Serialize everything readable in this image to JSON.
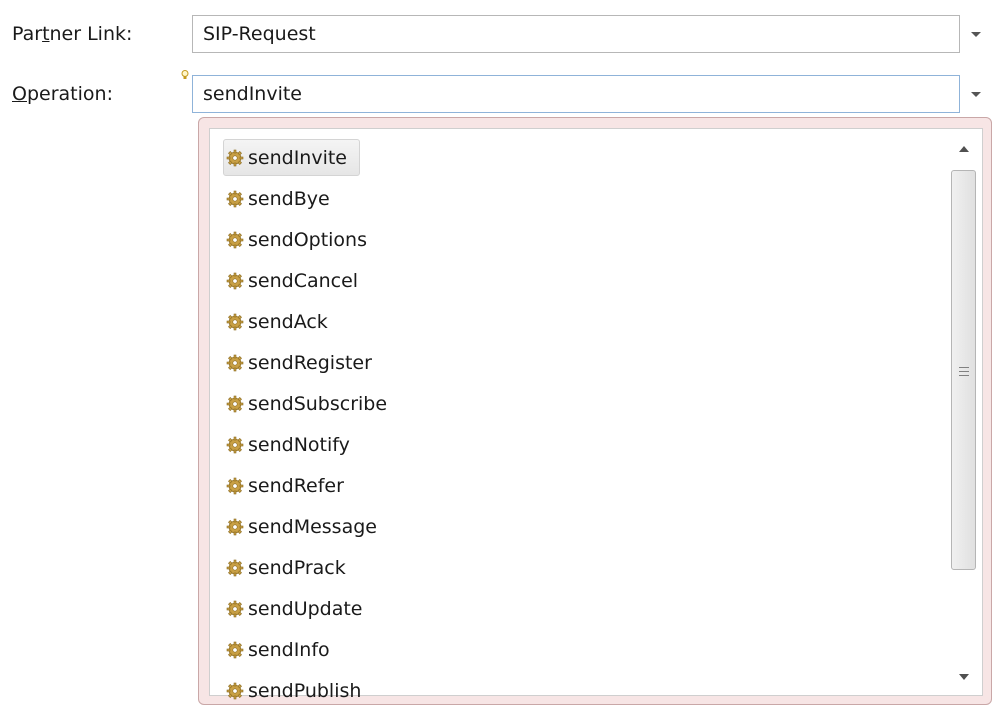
{
  "form": {
    "partner_link": {
      "label_pre": "Par",
      "label_mnemonic": "t",
      "label_post": "ner Link:",
      "value": "SIP-Request"
    },
    "operation": {
      "label_pre": "",
      "label_mnemonic": "O",
      "label_post": "peration:",
      "value": "sendInvite"
    }
  },
  "dropdown": {
    "selected": "sendInvite",
    "items": [
      "sendInvite",
      "sendBye",
      "sendOptions",
      "sendCancel",
      "sendAck",
      "sendRegister",
      "sendSubscribe",
      "sendNotify",
      "sendRefer",
      "sendMessage",
      "sendPrack",
      "sendUpdate",
      "sendInfo",
      "sendPublish"
    ]
  },
  "icons": {
    "operation_icon": "gear-icon",
    "hint_icon": "lightbulb-icon"
  },
  "colors": {
    "dropdown_border": "#c9a7a7",
    "dropdown_bg": "#f7e5e5",
    "gear": "#c9a045"
  }
}
